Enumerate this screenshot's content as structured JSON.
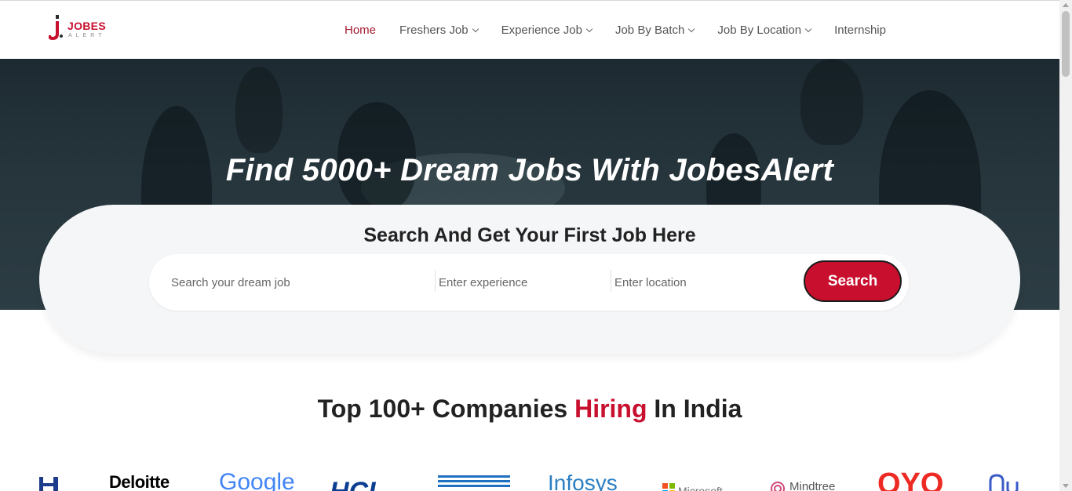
{
  "brand": {
    "name": "JOBES",
    "tagline": "ALERT",
    "colors": {
      "accent": "#c8102e",
      "nav_active": "#a51c30",
      "text": "#222222"
    }
  },
  "nav": {
    "items": [
      {
        "label": "Home",
        "active": true,
        "has_dropdown": false
      },
      {
        "label": "Freshers Job",
        "active": false,
        "has_dropdown": true
      },
      {
        "label": "Experience Job",
        "active": false,
        "has_dropdown": true
      },
      {
        "label": "Job By Batch",
        "active": false,
        "has_dropdown": true
      },
      {
        "label": "Job By Location",
        "active": false,
        "has_dropdown": true
      },
      {
        "label": "Internship",
        "active": false,
        "has_dropdown": false
      }
    ]
  },
  "hero": {
    "title": "Find 5000+ Dream Jobs With JobesAlert"
  },
  "search": {
    "heading": "Search And Get Your First Job Here",
    "job_placeholder": "Search your dream job",
    "experience_placeholder": "Enter experience",
    "location_placeholder": "Enter location",
    "button_label": "Search"
  },
  "companies": {
    "title_before": "Top 100+ Companies ",
    "title_highlight": "Hiring",
    "title_after": " In India",
    "logos": [
      {
        "name": "Deloitte",
        "color": "#000000"
      },
      {
        "name": "Google",
        "color": "#4285f4"
      },
      {
        "name": "HCL",
        "color": "#0b3d91"
      },
      {
        "name": "IBM",
        "color": "#1f70c1"
      },
      {
        "name": "Infosys",
        "color": "#2a7ec1"
      },
      {
        "name": "Microsoft",
        "color": "#737373"
      },
      {
        "name": "Mindtree",
        "color": "#555555"
      },
      {
        "name": "OYO",
        "color": "#ee2a24"
      }
    ]
  }
}
